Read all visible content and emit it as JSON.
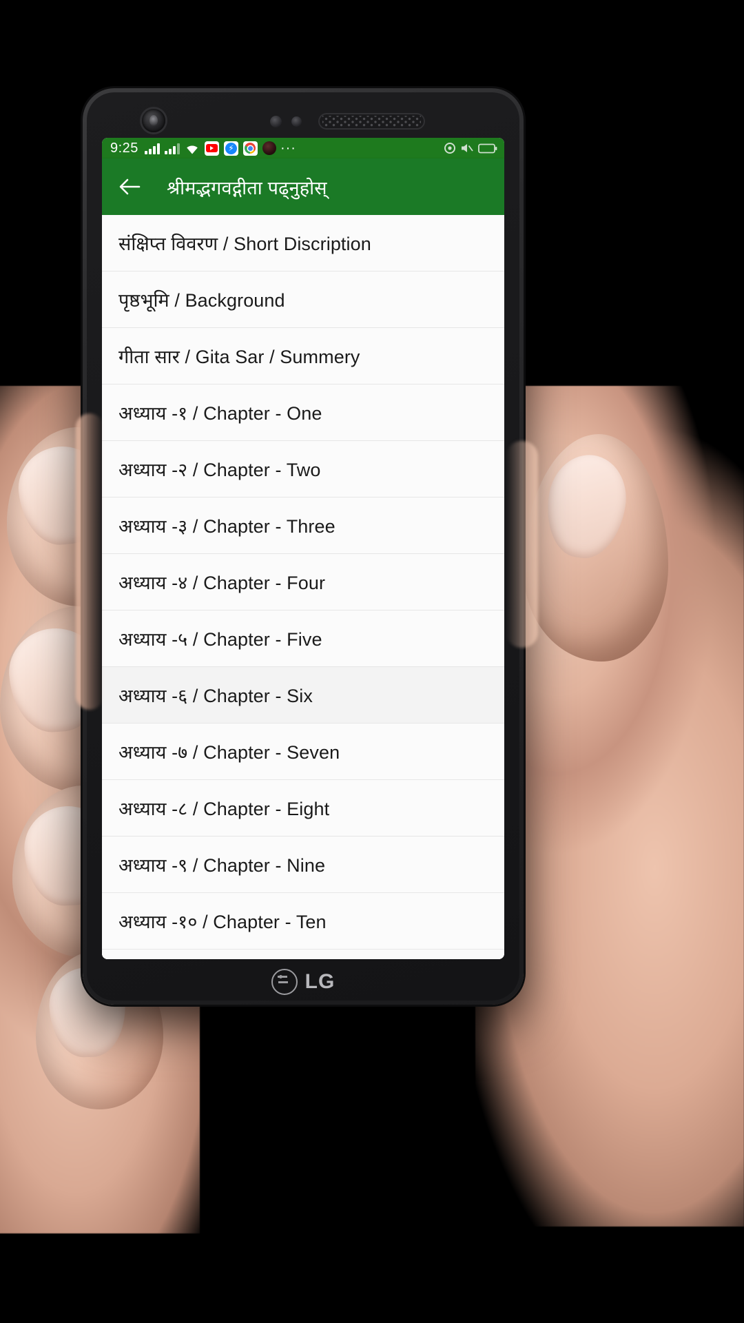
{
  "device": {
    "brand": "LG",
    "brand_icon": "lg-logo-icon"
  },
  "statusbar": {
    "time": "9:25",
    "signal_icon_1": "signal-bars-icon",
    "signal_icon_2": "signal-bars-icon",
    "wifi_icon": "wifi-icon",
    "notification_icons": [
      {
        "name": "youtube-icon",
        "label": "YouTube"
      },
      {
        "name": "messenger-icon",
        "label": "Messenger"
      },
      {
        "name": "chrome-icon",
        "label": "Chrome"
      },
      {
        "name": "app-notification-icon",
        "label": "App"
      }
    ],
    "more_icon": "more-notifications-icon",
    "more_glyph": "···",
    "right_icons": [
      {
        "name": "sync-icon"
      },
      {
        "name": "volume-mute-icon"
      },
      {
        "name": "battery-icon"
      }
    ]
  },
  "appbar": {
    "back_icon": "back-arrow-icon",
    "title": "श्रीमद्भगवद्गीता पढ्नुहोस्",
    "background_color": "#1b7a26",
    "text_color": "#ffffff"
  },
  "list": {
    "items": [
      {
        "label": "संक्षिप्त विवरण / Short Discription",
        "highlight": false
      },
      {
        "label": "पृष्ठभूमि / Background",
        "highlight": false
      },
      {
        "label": "गीता सार / Gita Sar / Summery",
        "highlight": false
      },
      {
        "label": "अध्याय -१ / Chapter - One",
        "highlight": false
      },
      {
        "label": "अध्याय -२ / Chapter - Two",
        "highlight": false
      },
      {
        "label": "अध्याय -३ / Chapter - Three",
        "highlight": false
      },
      {
        "label": "अध्याय -४ / Chapter - Four",
        "highlight": false
      },
      {
        "label": "अध्याय -५ / Chapter - Five",
        "highlight": false
      },
      {
        "label": "अध्याय -६ / Chapter - Six",
        "highlight": true
      },
      {
        "label": "अध्याय -७ / Chapter - Seven",
        "highlight": false
      },
      {
        "label": "अध्याय -८ / Chapter - Eight",
        "highlight": false
      },
      {
        "label": "अध्याय -९ / Chapter - Nine",
        "highlight": false
      },
      {
        "label": "अध्याय -१० / Chapter - Ten",
        "highlight": false
      }
    ]
  },
  "colors": {
    "status_bar": "#1e7a1e",
    "app_bar": "#1b7a26",
    "list_background": "#fbfbfb",
    "divider": "#e6e6e6",
    "text_primary": "#1a1a1a"
  }
}
